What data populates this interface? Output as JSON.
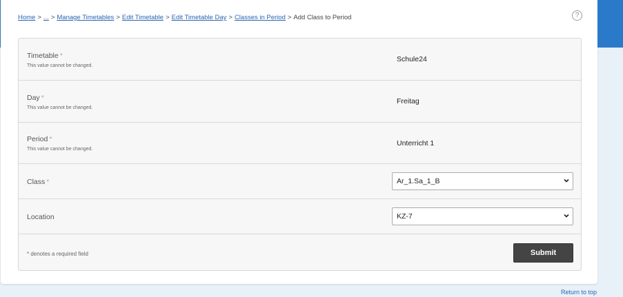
{
  "breadcrumb": {
    "items": [
      "Home",
      "...",
      "Manage Timetables",
      "Edit Timetable",
      "Edit Timetable Day",
      "Classes in Period"
    ],
    "current": "Add Class to Period",
    "separator": ">"
  },
  "help_icon": "?",
  "fields": {
    "timetable": {
      "label": "Timetable",
      "required": "*",
      "note": "This value cannot be changed.",
      "value": "Schule24"
    },
    "day": {
      "label": "Day",
      "required": "*",
      "note": "This value cannot be changed.",
      "value": "Freitag"
    },
    "period": {
      "label": "Period",
      "required": "*",
      "note": "This value cannot be changed.",
      "value": "Unterricht 1"
    },
    "class": {
      "label": "Class",
      "required": "*",
      "selected": "Ar_1.Sa_1_B"
    },
    "location": {
      "label": "Location",
      "selected": "KZ-7"
    }
  },
  "footer": {
    "required_note": "* denotes a required field",
    "submit_label": "Submit"
  },
  "return_to_top": "Return to top",
  "colors": {
    "accent": "#2a7ac9",
    "link": "#2a66b3",
    "button": "#444444"
  }
}
